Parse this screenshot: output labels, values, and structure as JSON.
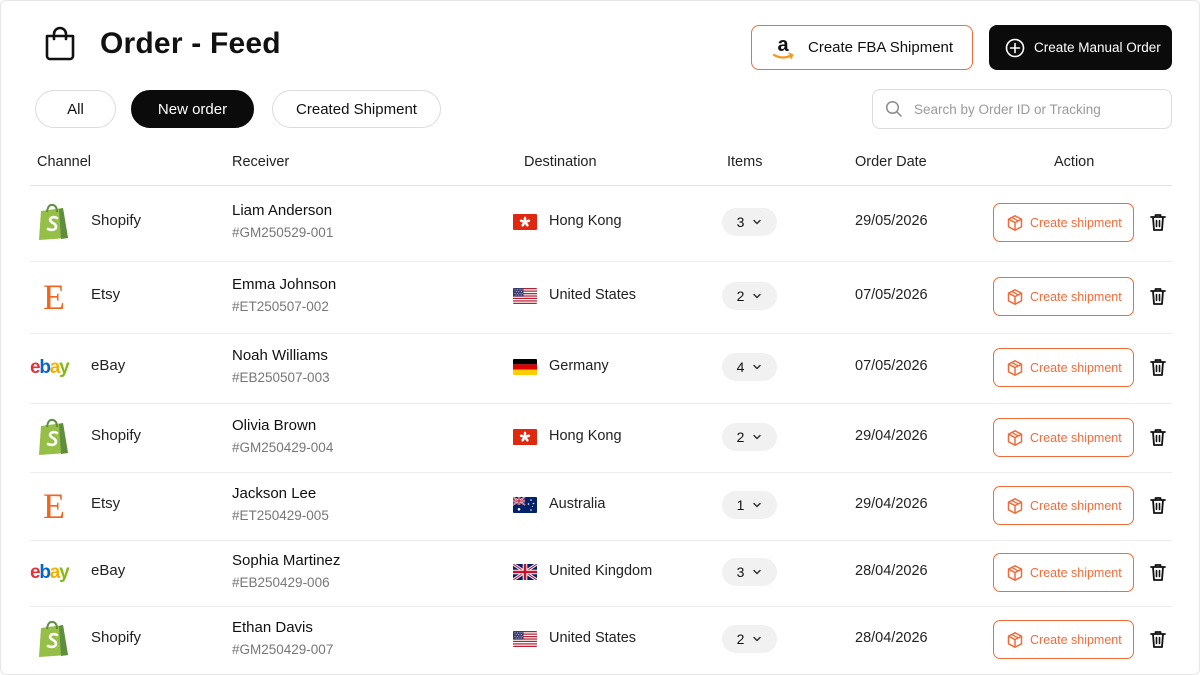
{
  "header": {
    "title": "Order - Feed",
    "fba_button_label": "Create FBA Shipment",
    "manual_button_label": "Create Manual Order"
  },
  "tabs": [
    {
      "label": "All",
      "active": false
    },
    {
      "label": "New order",
      "active": true
    },
    {
      "label": "Created Shipment",
      "active": false
    }
  ],
  "search": {
    "placeholder": "Search by Order ID or Tracking",
    "value": ""
  },
  "table": {
    "columns": [
      "Channel",
      "Receiver",
      "Destination",
      "Items",
      "Order Date",
      "Action"
    ],
    "action_label": "Create shipment",
    "rows": [
      {
        "channel": "Shopify",
        "channel_icon": "shopify-icon",
        "receiver": "Liam Anderson",
        "order_id": "#GM250529-001",
        "destination": "Hong Kong",
        "flag": "hong-kong-flag",
        "items": "3",
        "order_date": "29/05/2026"
      },
      {
        "channel": "Etsy",
        "channel_icon": "etsy-icon",
        "receiver": "Emma Johnson",
        "order_id": "#ET250507-002",
        "destination": "United States",
        "flag": "united-states-flag",
        "items": "2",
        "order_date": "07/05/2026"
      },
      {
        "channel": "eBay",
        "channel_icon": "ebay-icon",
        "receiver": "Noah Williams",
        "order_id": "#EB250507-003",
        "destination": "Germany",
        "flag": "germany-flag",
        "items": "4",
        "order_date": "07/05/2026"
      },
      {
        "channel": "Shopify",
        "channel_icon": "shopify-icon",
        "receiver": "Olivia Brown",
        "order_id": "#GM250429-004",
        "destination": "Hong Kong",
        "flag": "hong-kong-flag",
        "items": "2",
        "order_date": "29/04/2026"
      },
      {
        "channel": "Etsy",
        "channel_icon": "etsy-icon",
        "receiver": "Jackson Lee",
        "order_id": "#ET250429-005",
        "destination": "Australia",
        "flag": "australia-flag",
        "items": "1",
        "order_date": "29/04/2026"
      },
      {
        "channel": "eBay",
        "channel_icon": "ebay-icon",
        "receiver": "Sophia Martinez",
        "order_id": "#EB250429-006",
        "destination": "United Kingdom",
        "flag": "united-kingdom-flag",
        "items": "3",
        "order_date": "28/04/2026"
      },
      {
        "channel": "Shopify",
        "channel_icon": "shopify-icon",
        "receiver": "Ethan Davis",
        "order_id": "#GM250429-007",
        "destination": "United States",
        "flag": "united-states-flag",
        "items": "2",
        "order_date": "28/04/2026"
      }
    ]
  },
  "colors": {
    "accent": "#f26b3a",
    "primary_dark": "#0b0b0b",
    "shopify_green": "#95bf47",
    "etsy_orange": "#f1641e"
  }
}
